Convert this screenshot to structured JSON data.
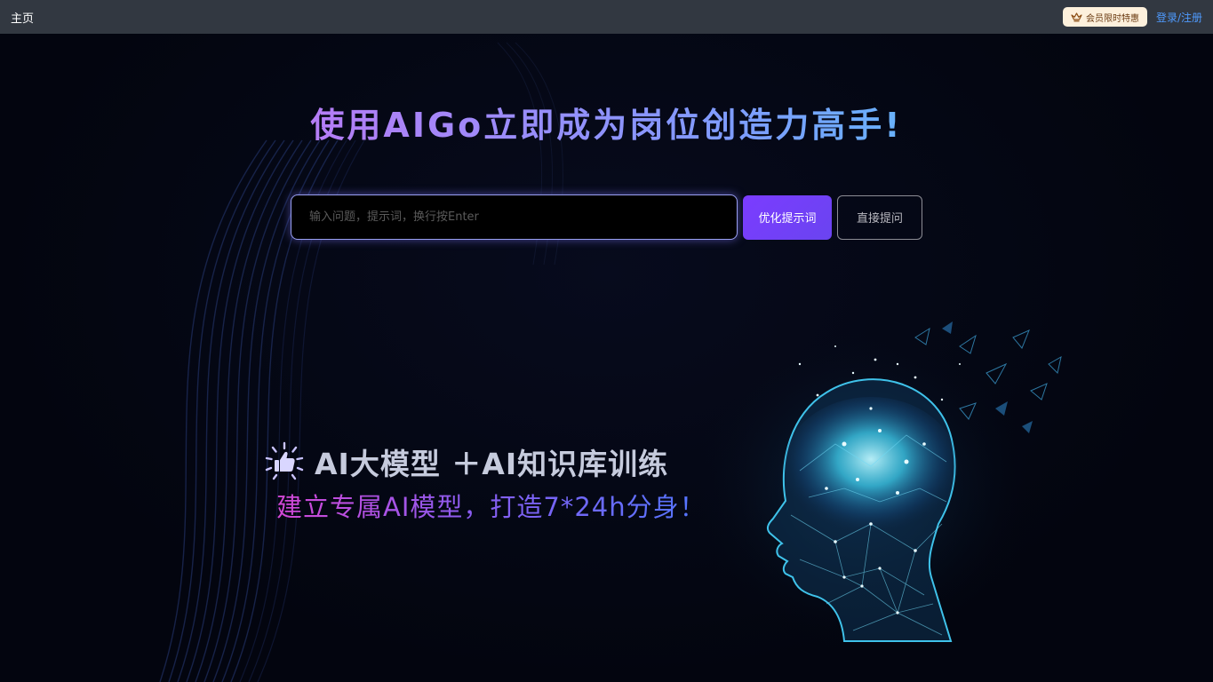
{
  "topbar": {
    "home_label": "主页",
    "vip_label": "会员限时特惠",
    "vip_icon": "crown-icon",
    "login_label": "登录/注册"
  },
  "hero": {
    "headline": "使用AIGo立即成为岗位创造力高手!"
  },
  "search": {
    "placeholder": "输入问题，提示词，换行按Enter",
    "value": "",
    "optimize_label": "优化提示词",
    "direct_label": "直接提问"
  },
  "promo": {
    "icon": "thumbs-up-icon",
    "title": "AI大模型 ＋AI知识库训练",
    "subtitle": "建立专属AI模型，打造7*24h分身！"
  },
  "illustration": {
    "icon": "ai-brain-head-icon"
  },
  "colors": {
    "topbar_bg": "#323841",
    "page_bg": "#03050f",
    "accent_purple": "#7b3cff",
    "link_blue": "#4f9bff",
    "vip_bg": "#fdf0dc"
  }
}
